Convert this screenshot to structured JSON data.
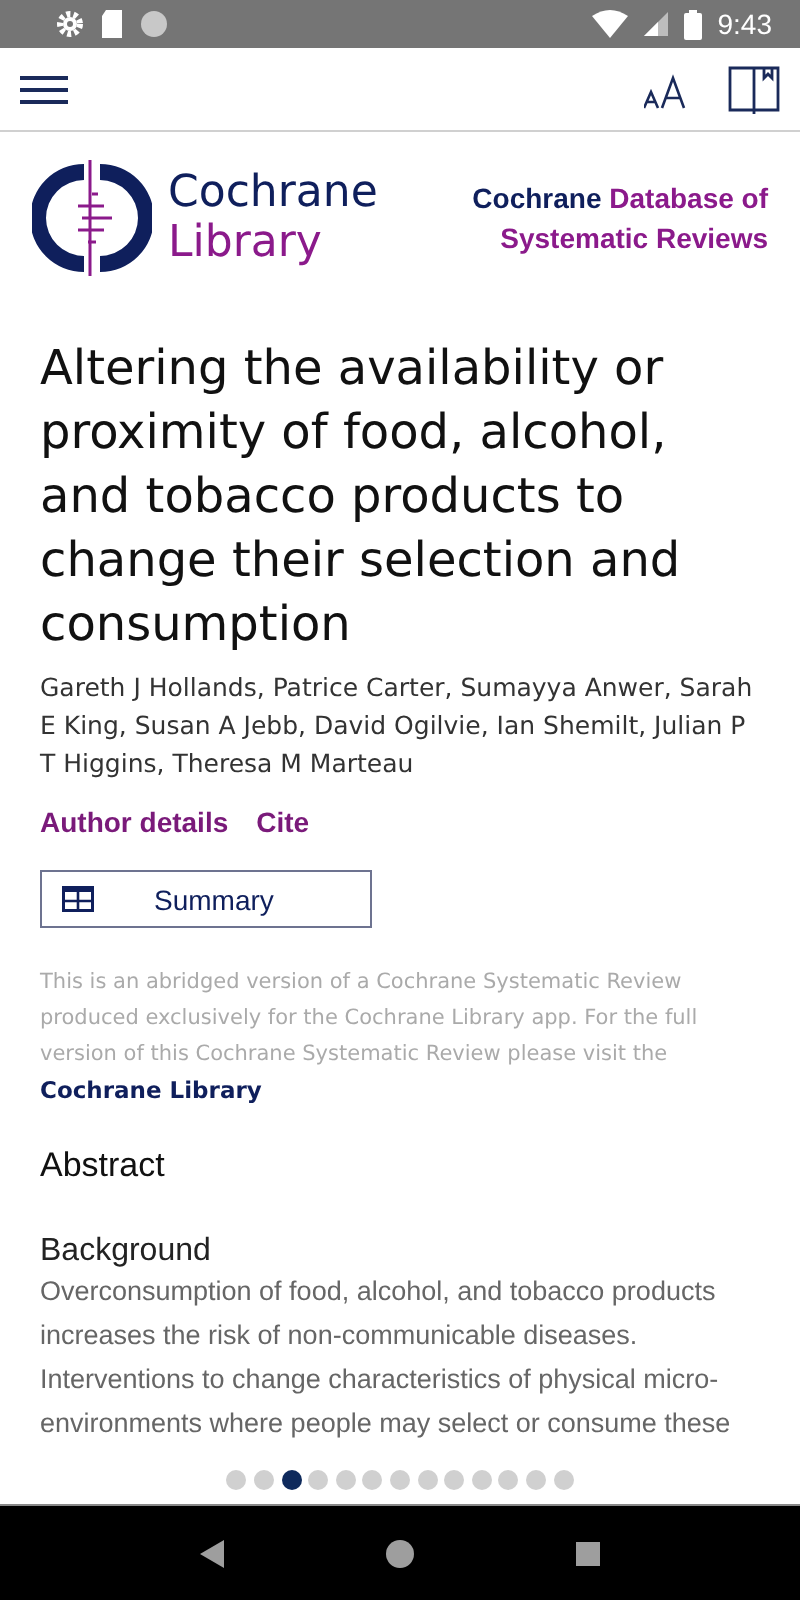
{
  "status_bar": {
    "time": "9:43"
  },
  "logo": {
    "line_1": "Cochrane",
    "line_2": "Library"
  },
  "journal": {
    "brand": "Cochrane",
    "name": "Database of Systematic Reviews"
  },
  "article": {
    "title": "Altering the availability or proximity of food, alcohol, and tobacco products to change their selection and consumption",
    "authors": "Gareth J Hollands, Patrice Carter, Sumayya Anwer, Sarah E King, Susan A Jebb, David Ogilvie, Ian Shemilt, Julian P T Higgins, Theresa M Marteau",
    "links": [
      "Author details",
      "Cite"
    ],
    "summary_button": "Summary",
    "disclaimer": "This is an abridged version of a Cochrane Systematic Review produced exclusively for the Cochrane Library app. For the full version of this Cochrane Systematic Review please visit the",
    "disclaimer_link": "Cochrane Library",
    "section_heading": "Abstract",
    "subheading": "Background",
    "body": "Overconsumption of food, alcohol, and tobacco products increases the risk of non-communicable diseases. Interventions to change characteristics of physical micro-environments where people may select or consume these"
  },
  "pager": [
    {
      "selected": false
    },
    {
      "selected": false
    },
    {
      "selected": true
    },
    {
      "selected": false
    },
    {
      "selected": false
    },
    {
      "selected": false
    },
    {
      "selected": false
    },
    {
      "selected": false
    },
    {
      "selected": false
    },
    {
      "selected": false
    },
    {
      "selected": false
    },
    {
      "selected": false
    },
    {
      "selected": false
    }
  ]
}
